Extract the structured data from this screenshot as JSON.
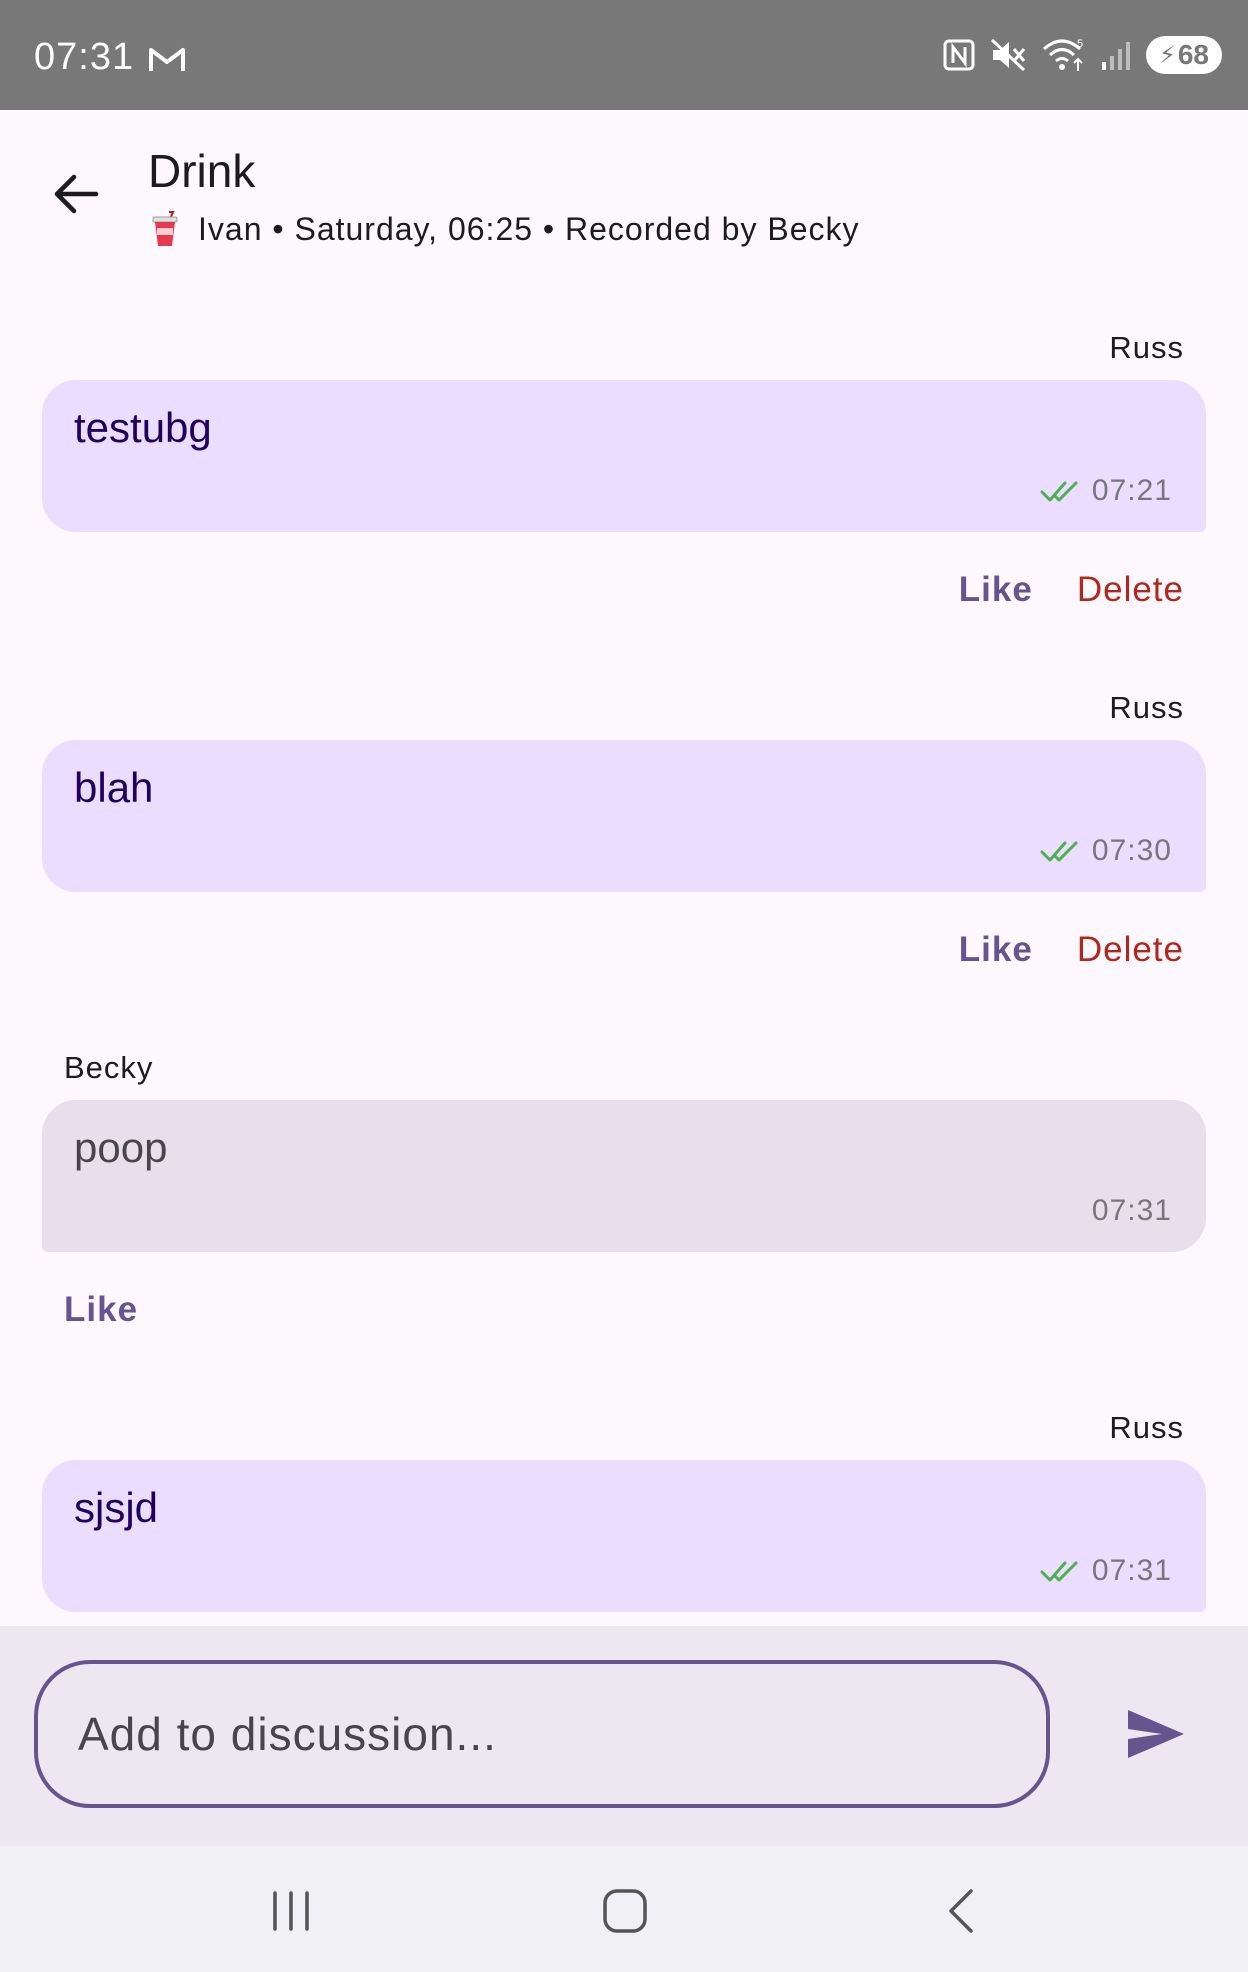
{
  "status_bar": {
    "time": "07:31",
    "battery": "68",
    "icons": [
      "gmail-icon",
      "nfc-icon",
      "mute-icon",
      "wifi-icon",
      "signal-icon",
      "battery-icon"
    ]
  },
  "header": {
    "title": "Drink",
    "subtitle": "Ivan • Saturday, 06:25 • Recorded by Becky",
    "back_icon": "arrow-back-icon",
    "category_icon": "cup-icon"
  },
  "messages": [
    {
      "author": "Russ",
      "text": "testubg",
      "time": "07:21",
      "mine": true,
      "read": true,
      "actions": {
        "like": "Like",
        "delete": "Delete"
      }
    },
    {
      "author": "Russ",
      "text": "blah",
      "time": "07:30",
      "mine": true,
      "read": true,
      "actions": {
        "like": "Like",
        "delete": "Delete"
      }
    },
    {
      "author": "Becky",
      "text": "poop",
      "time": "07:31",
      "mine": false,
      "read": false,
      "actions": {
        "like": "Like"
      }
    },
    {
      "author": "Russ",
      "text": "sjsjd",
      "time": "07:31",
      "mine": true,
      "read": true
    }
  ],
  "composer": {
    "placeholder": "Add to discussion...",
    "send_icon": "send-icon"
  },
  "nav_bar": {
    "icons": [
      "recents-icon",
      "home-icon",
      "back-icon"
    ]
  },
  "colors": {
    "accent": "#65558f",
    "own_bubble": "#eaddff",
    "other_bubble": "#e7e0ec",
    "delete": "#b3261e",
    "read_check": "#4caf50"
  }
}
